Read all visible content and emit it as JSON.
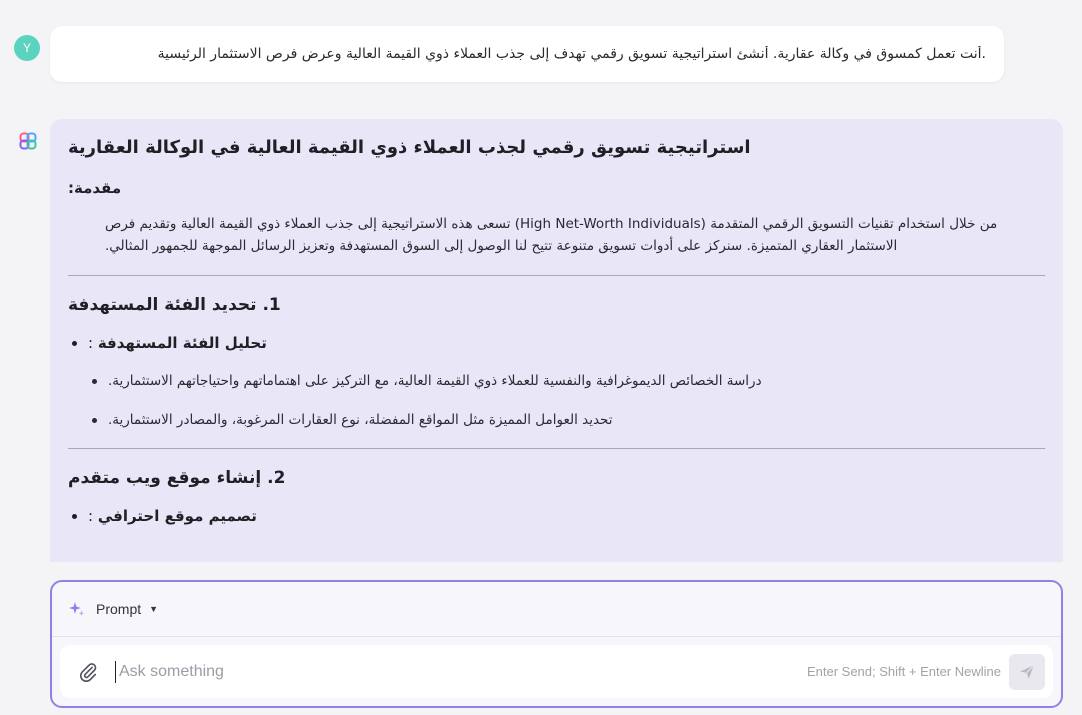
{
  "user": {
    "avatar_letter": "Y",
    "avatar_color": "#5bd3c0",
    "message": ".أنت تعمل كمسوق في وكالة عقارية. أنشئ استراتيجية تسويق رقمي تهدف إلى جذب العملاء ذوي القيمة العالية وعرض فرص الاستثمار الرئيسية"
  },
  "assistant": {
    "icon": "ai-logo-icon",
    "bubble_color": "#e9e6f8",
    "title": "استراتيجية تسويق رقمي لجذب العملاء ذوي القيمة العالية في الوكالة العقارية",
    "intro_heading": "مقدمة:",
    "intro_text_part1": "من خلال استخدام تقنيات التسويق الرقمي المتقدمة ",
    "intro_text_ltr": "(High Net-Worth Individuals)",
    "intro_text_part2": " تسعى هذه الاستراتيجية إلى جذب العملاء ذوي القيمة العالية وتقديم فرص الاستثمار العقاري المتميزة. سنركز على أدوات تسويق متنوعة تتيح لنا الوصول إلى السوق المستهدفة وتعزيز الرسائل الموجهة للجمهور المثالي.",
    "section1": {
      "heading": "1. تحديد الفئة المستهدفة",
      "bullet_label": "تحليل الفئة المستهدفة",
      "bullet_suffix": " :",
      "sub_items": [
        "دراسة الخصائص الديموغرافية والنفسية للعملاء ذوي القيمة العالية، مع التركيز على اهتماماتهم واحتياجاتهم الاستثمارية.",
        "تحديد العوامل المميزة مثل المواقع المفضلة، نوع العقارات المرغوبة، والمصادر الاستثمارية."
      ]
    },
    "section2": {
      "heading": "2. إنشاء موقع ويب متقدم",
      "bullet_label": "تصميم موقع احترافي",
      "bullet_suffix": " :"
    }
  },
  "composer": {
    "mode_label": "Prompt",
    "placeholder": "Ask something",
    "hint": "Enter Send; Shift + Enter Newline",
    "accent_color": "#8b83e8"
  }
}
